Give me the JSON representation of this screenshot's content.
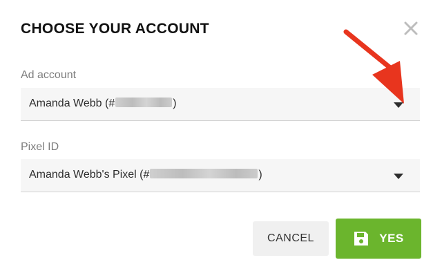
{
  "dialog": {
    "title": "CHOOSE YOUR ACCOUNT",
    "close_icon": "close-icon"
  },
  "ad_account": {
    "label": "Ad account",
    "value_prefix": "Amanda Webb (#",
    "value_suffix": ")",
    "caret_icon": "chevron-down-icon"
  },
  "pixel_id": {
    "label": "Pixel ID",
    "value_prefix": "Amanda Webb's Pixel (#",
    "value_suffix": ")",
    "caret_icon": "chevron-down-icon"
  },
  "actions": {
    "cancel_label": "CANCEL",
    "yes_label": "YES",
    "yes_icon": "save-icon"
  },
  "annotation": {
    "icon": "red-arrow-icon",
    "color": "#e8351e"
  },
  "colors": {
    "accent": "#6bb52d",
    "field_bg": "#f6f6f6"
  }
}
